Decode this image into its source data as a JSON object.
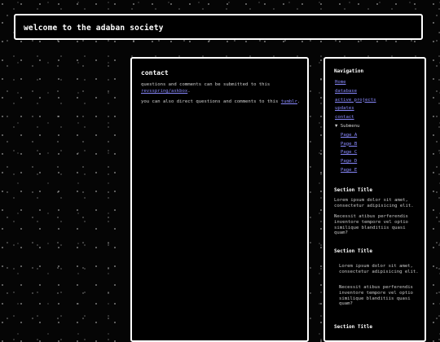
{
  "header": {
    "title": "welcome to the adaban society"
  },
  "main": {
    "heading": "contact",
    "p1_text": "questions and comments can be submitted to this ",
    "p1_link": "revsspring/askbox",
    "p1_end": ".",
    "p2_text": "you can also direct questions and comments to this ",
    "p2_link": "tumblr",
    "p2_end": "."
  },
  "sidebar": {
    "nav_title": "Navigation",
    "nav_items": [
      "Home",
      "database",
      "active projects",
      "updates",
      "contact"
    ],
    "submenu_label": "▼ Submenu",
    "submenu_items": [
      "Page A",
      "Page B",
      "Page C",
      "Page D",
      "Page E"
    ],
    "section1": {
      "title": "Section Title",
      "p1": "Lorem ipsum dolor sit amet, consectetur adipisicing elit.",
      "p2": "Necessit atibus perferendis inventore tempore vel optio similique blanditiis quasi quam?"
    },
    "section2": {
      "title": "Section Title",
      "p1": "Lorem ipsum dolor sit amet, consectetur adipisicing elit.",
      "p2": "Necessit atibus perferendis inventore tempore vel optio similique blanditiis quasi quam?"
    },
    "section3": {
      "title": "Section Title"
    }
  }
}
